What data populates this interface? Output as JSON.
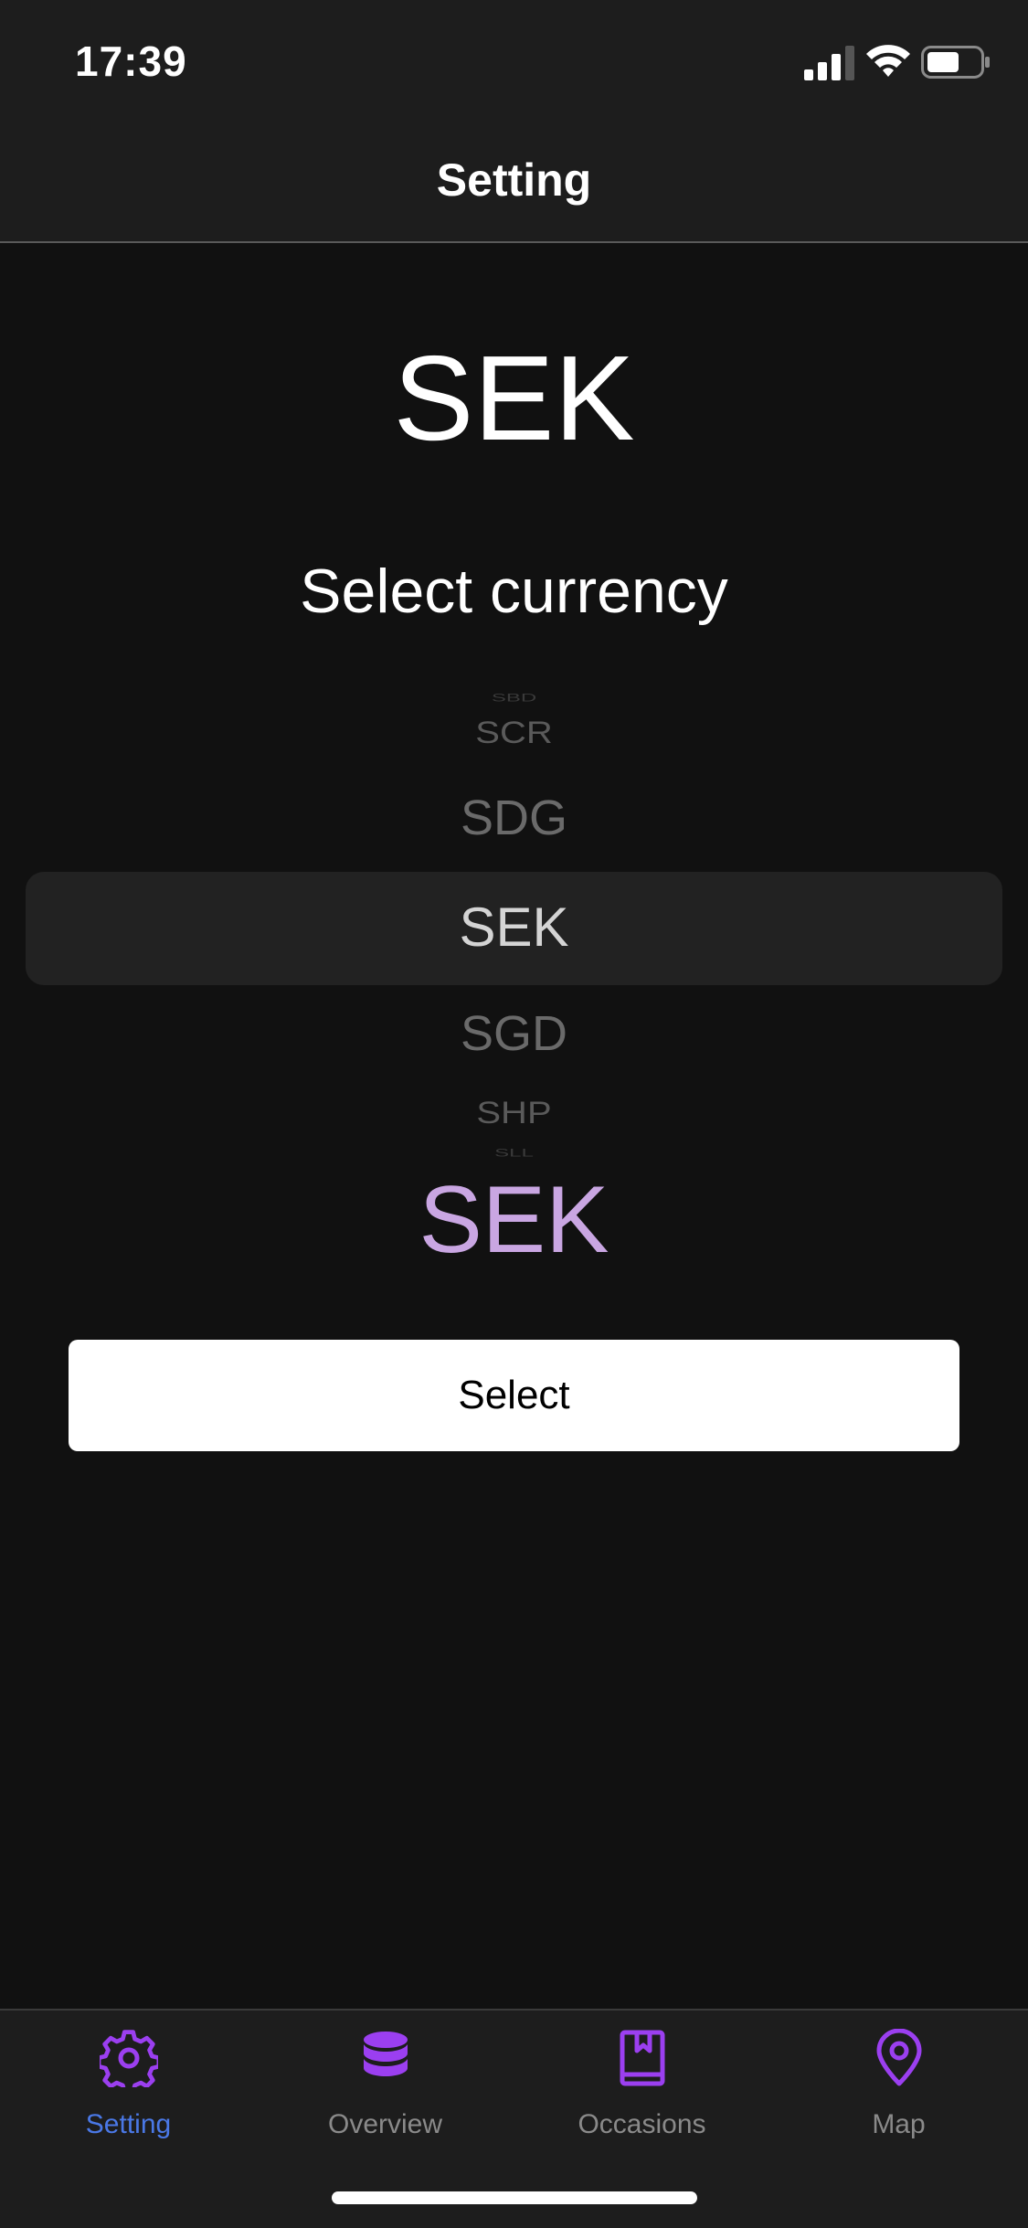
{
  "status_bar": {
    "time": "17:39",
    "icons": [
      "cellular-signal-icon",
      "wifi-icon",
      "battery-icon"
    ]
  },
  "nav": {
    "title": "Setting"
  },
  "main": {
    "current_currency": "SEK",
    "select_title": "Select currency",
    "picker": {
      "items": [
        "SBD",
        "SCR",
        "SDG",
        "SEK",
        "SGD",
        "SHP",
        "SLL"
      ],
      "selected": "SEK"
    },
    "selected_display": "SEK",
    "select_button_label": "Select"
  },
  "tab_bar": {
    "tabs": [
      {
        "label": "Setting",
        "icon": "gear-icon",
        "active": true
      },
      {
        "label": "Overview",
        "icon": "database-icon",
        "active": false
      },
      {
        "label": "Occasions",
        "icon": "bookmark-book-icon",
        "active": false
      },
      {
        "label": "Map",
        "icon": "map-pin-icon",
        "active": false
      }
    ]
  },
  "colors": {
    "background": "#111111",
    "bar_background": "#1d1d1d",
    "accent_purple": "#9b3ff0",
    "active_tab_label": "#4a78e6",
    "selected_code": "#c9a6e2"
  }
}
